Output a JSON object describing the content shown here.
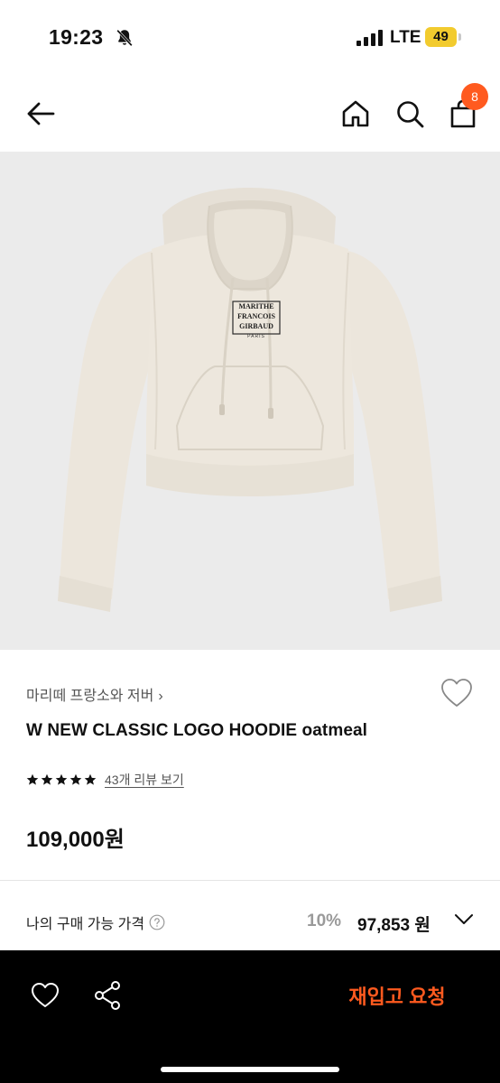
{
  "status_bar": {
    "time": "19:23",
    "network": "LTE",
    "battery": "49",
    "icons": [
      "bell-slash-icon",
      "signal-bars-icon"
    ]
  },
  "nav": {
    "back_icon": "arrow-left-icon",
    "home_icon": "home-icon",
    "search_icon": "search-icon",
    "cart_icon": "shopping-bag-icon",
    "cart_count": "8"
  },
  "product": {
    "image_icon": "hoodie-image",
    "logo_lines": [
      "MARITHE",
      "FRANCOIS",
      "GIRBAUD",
      "PARIS"
    ],
    "brand": "마리떼 프랑소와 저버",
    "name": "W NEW CLASSIC LOGO HOODIE oatmeal",
    "rating": 5,
    "review_link": "43개 리뷰 보기",
    "price": "109,000원"
  },
  "my_price": {
    "label": "나의 구매 가능 가격",
    "discount_rate": "10%",
    "discounted_price": "97,853 원"
  },
  "bottom_bar": {
    "restock_label": "재입고 요청"
  },
  "colors": {
    "accent": "#ff5a1f",
    "battery": "#f2cb2e",
    "image_bg": "#ebebeb",
    "hoodie": "#ece6dc"
  }
}
